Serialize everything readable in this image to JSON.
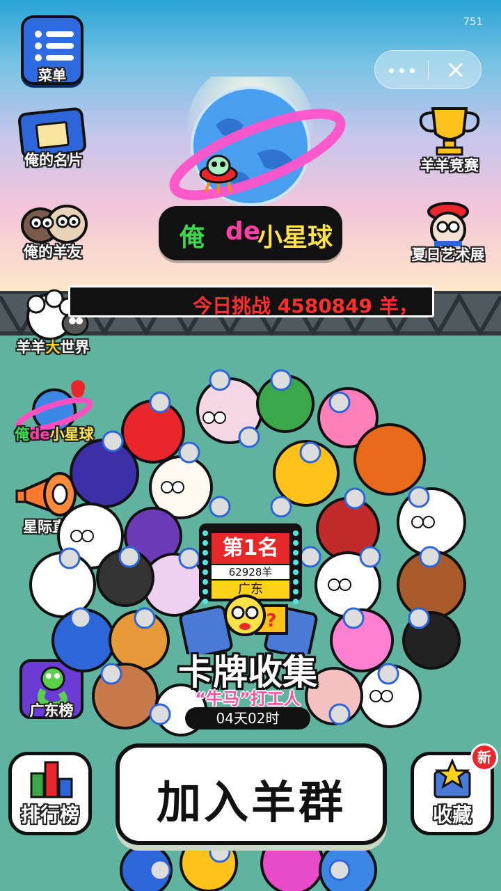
{
  "status": {
    "build_number": "751"
  },
  "capsule": {
    "more_icon": "more-dots-icon",
    "close_icon": "close-icon"
  },
  "left_menu": {
    "menu_label": "菜单",
    "card_label": "俺的名片",
    "friends_label": "俺的羊友",
    "world_label_a": "羊羊",
    "world_label_b": "大",
    "world_label_c": "世界",
    "myplanet_label_a": "俺",
    "myplanet_label_b": "de",
    "myplanet_label_c": "小星球",
    "hiring_label": "星际直聘",
    "guangdong_label": "广东榜"
  },
  "right_menu": {
    "trophy_label": "羊羊竞赛",
    "art_label": "夏日艺术展"
  },
  "planet": {
    "title_a": "俺",
    "title_b": "de",
    "title_c": "小星球"
  },
  "marquee": {
    "text": "今日挑战 4580849 羊，"
  },
  "rank_board": {
    "rank": "第1名",
    "score": "62928羊",
    "region": "广东"
  },
  "promo": {
    "title": "卡牌收集",
    "subtitle": "“牛马”打工人",
    "timer": "04天02时"
  },
  "bottom": {
    "join_label": "加入羊群",
    "leaderboard_label": "排行榜",
    "favorite_label": "收藏",
    "new_badge": "新"
  },
  "colors": {
    "sky_top": "#2aa3d6",
    "ground": "#5fb39f",
    "accent_red": "#e82828",
    "accent_yellow": "#ffd21a",
    "planet_green": "#3fd64f",
    "planet_pink": "#ff3fa6"
  }
}
